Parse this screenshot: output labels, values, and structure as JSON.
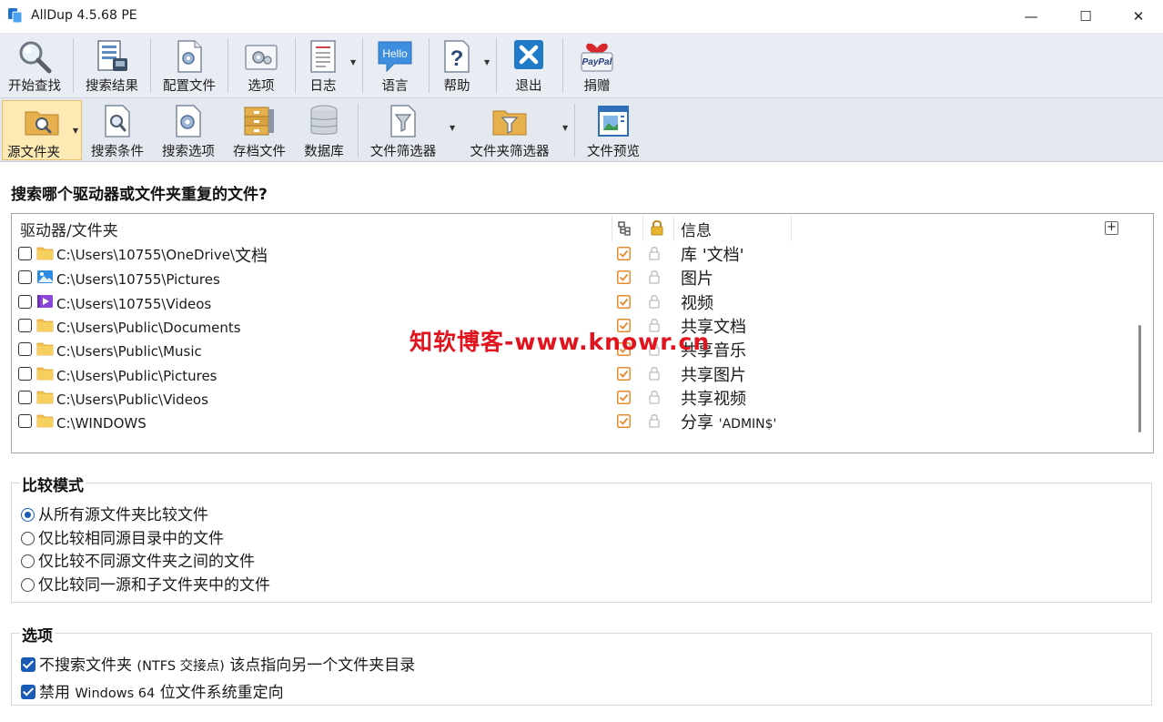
{
  "window": {
    "title": "AllDup 4.5.68 PE",
    "minimize": "—",
    "maximize": "☐",
    "close": "✕"
  },
  "toolbar_main": [
    {
      "label": "开始查找",
      "icon": "magnifier-icon"
    },
    {
      "label": "搜索结果",
      "icon": "search-results-icon"
    },
    {
      "label": "配置文件",
      "icon": "config-file-icon"
    },
    {
      "label": "选项",
      "icon": "options-icon"
    },
    {
      "label": "日志",
      "icon": "log-icon"
    },
    {
      "label": "语言",
      "icon": "language-icon",
      "icon_text": "Hello"
    },
    {
      "label": "帮助",
      "icon": "help-icon"
    },
    {
      "label": "退出",
      "icon": "exit-icon"
    },
    {
      "label": "捐赠",
      "icon": "donate-icon",
      "icon_text": "PayPal"
    }
  ],
  "toolbar_tabs": [
    {
      "label": "源文件夹",
      "icon": "source-folder-icon",
      "active": true
    },
    {
      "label": "搜索条件",
      "icon": "search-criteria-icon"
    },
    {
      "label": "搜索选项",
      "icon": "search-options-icon"
    },
    {
      "label": "存档文件",
      "icon": "archive-icon"
    },
    {
      "label": "数据库",
      "icon": "database-icon"
    },
    {
      "label": "文件筛选器",
      "icon": "file-filter-icon"
    },
    {
      "label": "文件夹筛选器",
      "icon": "folder-filter-icon"
    },
    {
      "label": "文件预览",
      "icon": "file-preview-icon"
    }
  ],
  "main": {
    "heading": "搜索哪个驱动器或文件夹重复的文件?",
    "columns": {
      "drive_folder": "驱动器/文件夹",
      "info": "信息",
      "add": "+"
    },
    "rows": [
      {
        "path": "C:\\Users\\10755\\OneDrive\\",
        "path_suffix": "文档",
        "info": "库 '文档'",
        "icon": "folder-icon",
        "checked": false,
        "sub": true
      },
      {
        "path": "C:\\Users\\10755\\Pictures",
        "path_suffix": "",
        "info": "图片",
        "icon": "pictures-folder-icon",
        "checked": false,
        "sub": true
      },
      {
        "path": "C:\\Users\\10755\\Videos",
        "path_suffix": "",
        "info": "视频",
        "icon": "videos-folder-icon",
        "checked": false,
        "sub": true
      },
      {
        "path": "C:\\Users\\Public\\Documents",
        "path_suffix": "",
        "info": "共享文档",
        "icon": "folder-icon",
        "checked": false,
        "sub": true
      },
      {
        "path": "C:\\Users\\Public\\Music",
        "path_suffix": "",
        "info": "共享音乐",
        "icon": "folder-icon",
        "checked": false,
        "sub": true
      },
      {
        "path": "C:\\Users\\Public\\Pictures",
        "path_suffix": "",
        "info": "共享图片",
        "icon": "folder-icon",
        "checked": false,
        "sub": true
      },
      {
        "path": "C:\\Users\\Public\\Videos",
        "path_suffix": "",
        "info": "共享视频",
        "icon": "folder-icon",
        "checked": false,
        "sub": true
      },
      {
        "path": "C:\\WINDOWS",
        "path_suffix": "",
        "info": "分享",
        "info_suffix": "'ADMIN$'",
        "icon": "folder-icon",
        "checked": false,
        "sub": true
      }
    ],
    "watermark": "知软博客-www.knowr.cn"
  },
  "compare_mode": {
    "title": "比较模式",
    "options": [
      {
        "label": "从所有源文件夹比较文件",
        "selected": true
      },
      {
        "label": "仅比较相同源目录中的文件",
        "selected": false
      },
      {
        "label": "仅比较不同源文件夹之间的文件",
        "selected": false
      },
      {
        "label": "仅比较同一源和子文件夹中的文件",
        "selected": false
      }
    ]
  },
  "options": {
    "title": "选项",
    "items": [
      {
        "pre": "不搜索文件夹",
        "mid": "(NTFS 交接点)",
        "post": "该点指向另一个文件夹目录",
        "checked": true
      },
      {
        "pre": "禁用",
        "mid": "Windows 64",
        "post": "位文件系统重定向",
        "checked": true
      }
    ]
  },
  "colors": {
    "accent": "#1a5bb8",
    "toolbar_bg": "#e9edf3",
    "active_tab": "#fde9b4",
    "subfolder_check": "#e68a2e",
    "watermark": "#e0141e"
  }
}
